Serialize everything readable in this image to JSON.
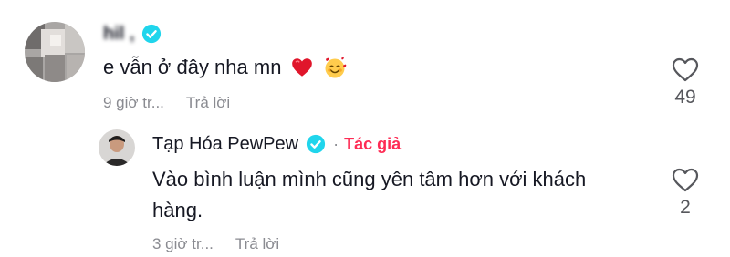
{
  "comments": [
    {
      "username": "hil , ",
      "text": "e vẫn ở đây nha mn",
      "emojis": [
        "red-heart",
        "smiling-face-with-hearts"
      ],
      "timestamp": "9 giờ tr...",
      "reply_label": "Trả lời",
      "likes": "49",
      "verified": true
    }
  ],
  "replies": [
    {
      "username": "Tạp Hóa PewPew",
      "verified": true,
      "separator": "·",
      "author_badge": "Tác giả",
      "text": "Vào bình luận mình cũng yên tâm hơn với khách hàng.",
      "timestamp": "3 giờ tr...",
      "reply_label": "Trả lời",
      "likes": "2"
    }
  ],
  "colors": {
    "verified_blue": "#20d5ec",
    "author_red": "#fe2c55",
    "meta_gray": "#8a8b91",
    "text_dark": "#161823"
  }
}
